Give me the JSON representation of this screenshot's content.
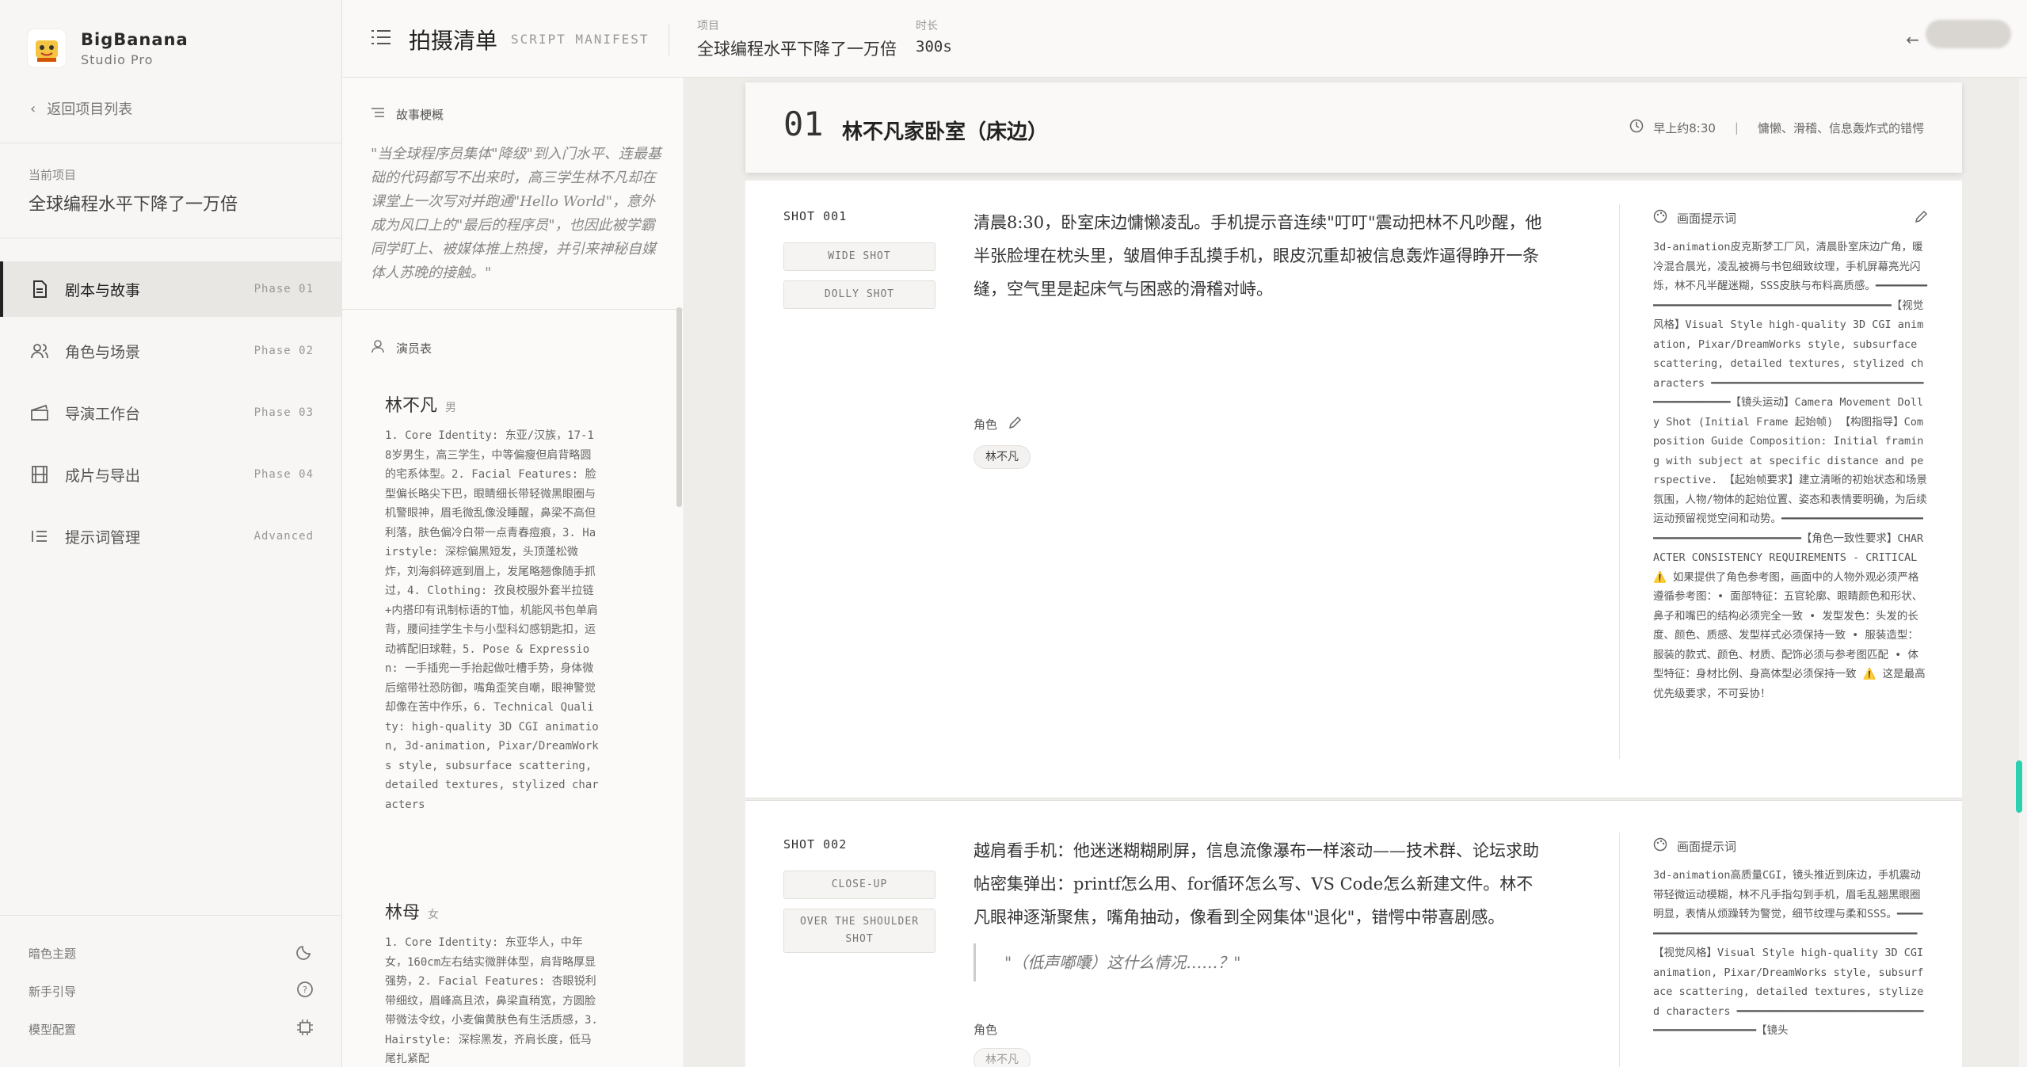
{
  "brand": {
    "name": "BigBanana",
    "sub": "Studio Pro"
  },
  "sidebar": {
    "back": "返回项目列表",
    "current_label": "当前项目",
    "current_name": "全球编程水平下降了一万倍",
    "nav": [
      {
        "label": "剧本与故事",
        "phase": "Phase 01",
        "icon": "document-icon"
      },
      {
        "label": "角色与场景",
        "phase": "Phase 02",
        "icon": "users-icon"
      },
      {
        "label": "导演工作台",
        "phase": "Phase 03",
        "icon": "clapperboard-icon"
      },
      {
        "label": "成片与导出",
        "phase": "Phase 04",
        "icon": "film-icon"
      },
      {
        "label": "提示词管理",
        "phase": "Advanced",
        "icon": "list-icon"
      }
    ],
    "footer": {
      "theme": "暗色主题",
      "guide": "新手引导",
      "model": "模型配置"
    }
  },
  "topbar": {
    "title": "拍摄清单",
    "title_en": "SCRIPT MANIFEST",
    "project_label": "项目",
    "project_value": "全球编程水平下降了一万倍",
    "duration_label": "时长",
    "duration_value": "300s"
  },
  "story": {
    "synopsis_title": "故事梗概",
    "synopsis": "\"当全球程序员集体\"降级\"到入门水平、连最基础的代码都写不出来时，高三学生林不凡却在课堂上一次写对并跑通\"Hello World\"，意外成为风口上的\"最后的程序员\"，也因此被学霸同学盯上、被媒体推上热搜，并引来神秘自媒体人苏晚的接触。\"",
    "cast_title": "演员表",
    "cast": [
      {
        "name": "林不凡",
        "gender": "男",
        "desc": "1. Core Identity: 东亚/汉族，17-18岁男生，高三学生，中等偏瘦但肩背略圆的宅系体型。2. Facial Features: 脸型偏长略尖下巴，眼睛细长带轻微黑眼圈与机警眼神，眉毛微乱像没睡醒，鼻梁不高但利落，肤色偏冷白带一点青春痘痕，3. Hairstyle: 深棕偏黑短发，头顶蓬松微炸，刘海斜碎遮到眉上，发尾略翘像随手抓过，4. Clothing: 孜良校服外套半拉链+内搭印有讯制标语的T恤，机能风书包单肩背，腰间挂学生卡与小型科幻感钥匙扣，运动裤配旧球鞋，5. Pose & Expression: 一手插兜一手抬起做吐槽手势，身体微后缩带社恐防御，嘴角歪笑自嘲，眼神警觉却像在苦中作乐，6. Technical Quality: high-quality 3D CGI animation, 3d-animation, Pixar/DreamWorks style, subsurface scattering, detailed textures, stylized characters"
      },
      {
        "name": "林母",
        "gender": "女",
        "desc": "1. Core Identity: 东亚华人，中年女，160cm左右结实微胖体型，肩背略厚显强势，2. Facial Features: 杏眼锐利带细纹，眉峰高且浓，鼻梁直稍宽，方圆脸带微法令纹，小麦偏黄肤色有生活质感，3. Hairstyle: 深棕黑发，齐肩长度，低马尾扎紧配"
      }
    ]
  },
  "scene": {
    "number": "01",
    "title": "林不凡家卧室（床边）",
    "time": "早上约8:30",
    "mood": "慵懒、滑稽、信息轰炸式的错愕"
  },
  "shots": [
    {
      "id": "SHOT 001",
      "tags": [
        "WIDE SHOT",
        "DOLLY SHOT"
      ],
      "text": "清晨8:30，卧室床边慵懒凌乱。手机提示音连续\"叮叮\"震动把林不凡吵醒，他半张脸埋在枕头里，皱眉伸手乱摸手机，眼皮沉重却被信息轰炸逼得睁开一条缝，空气里是起床气与困惑的滑稽对峙。",
      "role_label": "角色",
      "roles": [
        "林不凡"
      ],
      "prompt_label": "画面提示词",
      "prompt": "3d-animation皮克斯梦工厂风，清晨卧室床边广角，暖冷混合晨光，凌乱被褥与书包细致纹理，手机屏幕亮光闪烁，林不凡半醒迷糊，SSS皮肤与布料高质感。━━━━━━━━━━━━━━━━━━━━━━━━━━━━━━━━━━━━━━━━━━━━━【视觉风格】Visual Style high-quality 3D CGI animation, Pixar/DreamWorks style, subsurface scattering, detailed textures, stylized characters ━━━━━━━━━━━━━━━━━━━━━━━━━━━━━━━━━━━━━━━━━━━━━【镜头运动】Camera Movement Dolly Shot (Initial Frame 起始帧) 【构图指导】Composition Guide Composition: Initial framing with subject at specific distance and perspective. 【起始帧要求】建立清晰的初始状态和场景氛围，人物/物体的起始位置、姿态和表情要明确，为后续运动预留视觉空间和动势。━━━━━━━━━━━━━━━━━━━━━━━━━━━━━━━━━━━━━━━━━━━━━【角色一致性要求】CHARACTER CONSISTENCY REQUIREMENTS - CRITICAL ⚠️ 如果提供了角色参考图，画面中的人物外观必须严格遵循参考图：• 面部特征：五官轮廓、眼睛颜色和形状、鼻子和嘴巴的结构必须完全一致 • 发型发色：头发的长度、颜色、质感、发型样式必须保持一致 • 服装造型：服装的款式、颜色、材质、配饰必须与参考图匹配 • 体型特征：身材比例、身高体型必须保持一致 ⚠️ 这是最高优先级要求，不可妥协！"
    },
    {
      "id": "SHOT 002",
      "tags": [
        "CLOSE-UP",
        "OVER THE SHOULDER SHOT"
      ],
      "text": "越肩看手机：他迷迷糊糊刷屏，信息流像瀑布一样滚动——技术群、论坛求助帖密集弹出：printf怎么用、for循环怎么写、VS Code怎么新建文件。林不凡眼神逐渐聚焦，嘴角抽动，像看到全网集体\"退化\"，错愕中带喜剧感。",
      "quote": "\"（低声嘟囔）这什么情况……？\"",
      "role_label": "角色",
      "roles": [
        "林不凡"
      ],
      "prompt_label": "画面提示词",
      "prompt": "3d-animation高质量CGI，镜头推近到床边，手机震动带轻微运动模糊，林不凡手指勾到手机，眉毛乱翘黑眼圈明显，表情从烦躁转为警觉，细节纹理与柔和SSS。━━━━━━━━━━━━━━━━━━━━━━━━━━━━━━━━━━━━━━━━━━━━━【视觉风格】Visual Style high-quality 3D CGI animation, Pixar/DreamWorks style, subsurface scattering, detailed textures, stylized characters ━━━━━━━━━━━━━━━━━━━━━━━━━━━━━━━━━━━━━━━━━━━━━【镜头"
    }
  ]
}
